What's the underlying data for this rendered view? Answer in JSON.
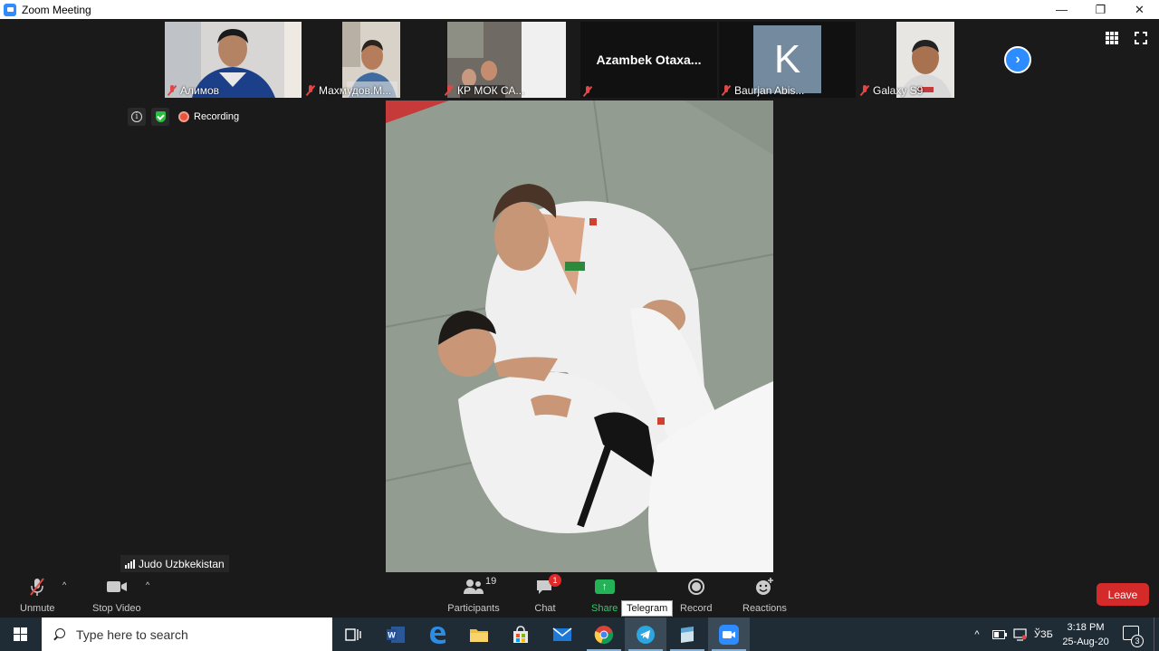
{
  "window": {
    "title": "Zoom Meeting",
    "minimize": "—",
    "restore": "❐",
    "close": "✕"
  },
  "participants_strip": [
    {
      "name": "Алимов",
      "muted": true
    },
    {
      "name": "Махмудов.М...",
      "muted": true
    },
    {
      "name": "КР МОК СА...",
      "muted": true
    },
    {
      "name": "",
      "display_name": "Azambek  Otaxa...",
      "muted": true
    },
    {
      "name": "Baurjan Abis...",
      "muted": true,
      "avatar_letter": "K"
    },
    {
      "name": "Galaxy S9",
      "muted": true
    }
  ],
  "status": {
    "recording_label": "Recording"
  },
  "active_speaker": {
    "name": "Judo Uzbkekistan"
  },
  "toolbar": {
    "unmute": "Unmute",
    "stop_video": "Stop Video",
    "participants": "Participants",
    "participants_count": "19",
    "chat": "Chat",
    "chat_badge": "1",
    "share": "Share",
    "record": "Record",
    "reactions": "Reactions",
    "leave": "Leave",
    "tooltip": "Telegram"
  },
  "taskbar": {
    "search_placeholder": "Type here to search",
    "language": "ЎЗБ",
    "time": "3:18 PM",
    "date": "25-Aug-20",
    "notification_count": "3"
  },
  "colors": {
    "zoom_blue": "#2d8cff",
    "leave_red": "#d42a2a",
    "share_green": "#23b257",
    "taskbar": "#1f2b35"
  }
}
